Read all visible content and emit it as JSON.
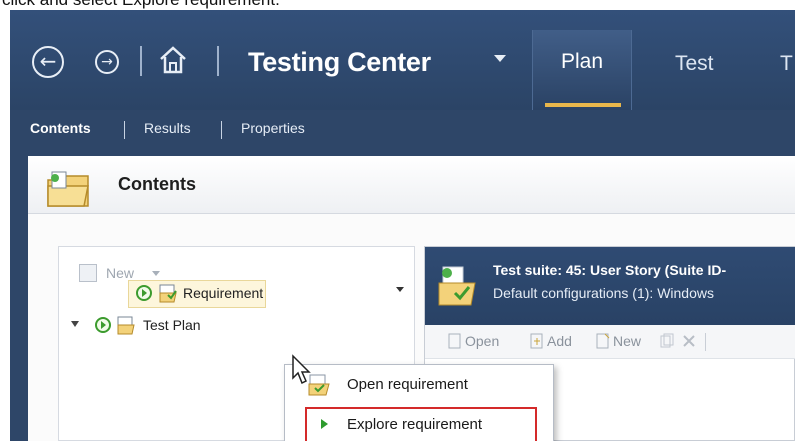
{
  "caption": "click and select Explore requirement.",
  "topbar": {
    "back_icon": "back-arrow-icon",
    "forward_icon": "forward-arrow-icon",
    "home_icon": "home-icon",
    "app_title": "Testing Center",
    "tabs": [
      {
        "label": "Plan",
        "active": true
      },
      {
        "label": "Test",
        "active": false
      },
      {
        "label": "T",
        "active": false
      }
    ],
    "accent_color": "#e8b64b",
    "bar_color": "#2e4668"
  },
  "subnav": {
    "items": [
      {
        "label": "Contents",
        "active": true
      },
      {
        "label": "Results",
        "active": false
      },
      {
        "label": "Properties",
        "active": false
      }
    ]
  },
  "contents": {
    "title": "Contents"
  },
  "tree": {
    "new_button": "New",
    "items": [
      {
        "label": "Test Plan",
        "expanded": true
      },
      {
        "label": "Requirement",
        "selected": true
      }
    ]
  },
  "suite": {
    "title": "Test suite:  45: User Story (Suite ID-",
    "config": "Default configurations (1):  Windows",
    "toolbar": [
      "Open",
      "Add",
      "New"
    ]
  },
  "context_menu": {
    "items": [
      {
        "label": "Open requirement",
        "icon": "open-requirement-icon"
      },
      {
        "label": "Explore requirement",
        "icon": "play-icon",
        "highlighted": true
      }
    ],
    "highlight_color": "#d42a2a"
  }
}
